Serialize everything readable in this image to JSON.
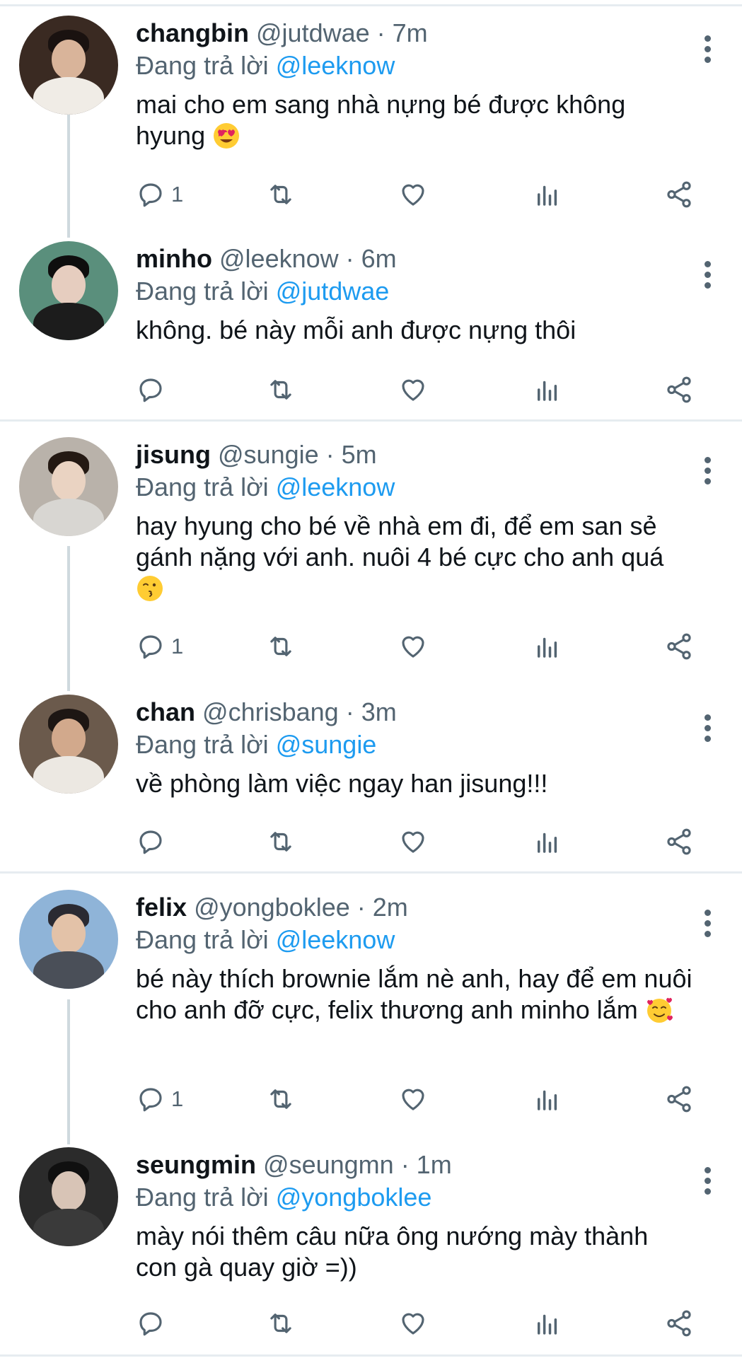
{
  "reply_prefix": "Đang trả lời",
  "colors": {
    "accent": "#1d9bf0",
    "muted": "#536471",
    "text": "#0f1419",
    "divider": "#e6ecf0",
    "thread": "#cfd9de"
  },
  "tweets": [
    {
      "name": "changbin",
      "handle": "@jutdwae",
      "time": "· 7m",
      "reply_to": "@leeknow",
      "text": "mai cho em sang nhà nựng bé được không hyung",
      "emoji": "heart-eyes",
      "reply_count": "1"
    },
    {
      "name": "minho",
      "handle": "@leeknow",
      "time": "· 6m",
      "reply_to": "@jutdwae",
      "text": "không. bé này mỗi anh được nựng thôi",
      "emoji": "",
      "reply_count": ""
    },
    {
      "name": "jisung",
      "handle": "@sungie",
      "time": "· 5m",
      "reply_to": "@leeknow",
      "text": "hay hyung cho bé về nhà em đi, để em san sẻ gánh nặng với anh. nuôi 4 bé cực cho anh quá",
      "emoji": "kissing",
      "reply_count": "1"
    },
    {
      "name": "chan",
      "handle": "@chrisbang",
      "time": "· 3m",
      "reply_to": "@sungie",
      "text": "về phòng làm việc ngay han jisung!!!",
      "emoji": "",
      "reply_count": ""
    },
    {
      "name": "felix",
      "handle": "@yongboklee",
      "time": "· 2m",
      "reply_to": "@leeknow",
      "text": "bé này thích brownie lắm nè anh, hay để em nuôi cho anh đỡ cực, felix thương anh minho lắm",
      "emoji": "smiling-hearts",
      "reply_count": "1"
    },
    {
      "name": "seungmin",
      "handle": "@seungmn",
      "time": "· 1m",
      "reply_to": "@yongboklee",
      "text": "mày nói thêm câu nữa ông nướng mày thành con gà quay giờ =))",
      "emoji": "",
      "reply_count": ""
    }
  ]
}
